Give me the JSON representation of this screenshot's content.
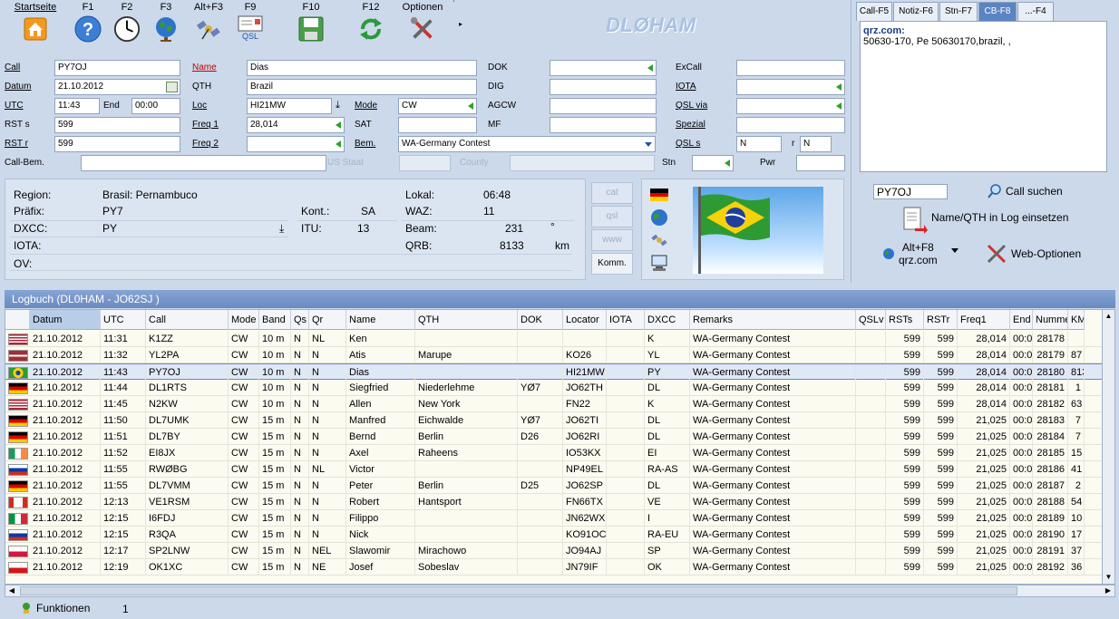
{
  "toolbar": {
    "buttons": [
      {
        "label": "Startseite",
        "icon": "home-icon"
      },
      {
        "label": "F1",
        "icon": "help-icon"
      },
      {
        "label": "F2",
        "icon": "clock-icon"
      },
      {
        "label": "F3",
        "icon": "globe-icon"
      },
      {
        "label": "Alt+F3",
        "icon": "satellite-icon"
      },
      {
        "label": "F9",
        "icon": "qsl-card-icon",
        "sub": "QSL"
      },
      {
        "label": "F10",
        "icon": "save-icon"
      },
      {
        "label": "F12",
        "icon": "refresh-icon"
      },
      {
        "label": "Optionen",
        "icon": "tools-icon"
      }
    ],
    "logo": "DLØHAM"
  },
  "form": {
    "call_label": "Call",
    "call": "PY7OJ",
    "datum_label": "Datum",
    "datum": "21.10.2012",
    "utc_label": "UTC",
    "utc": "11:43",
    "end_label": "End",
    "end": "00:00",
    "rsts_label": "RST s",
    "rsts": "599",
    "rstr_label": "RST r",
    "rstr": "599",
    "callbem_label": "Call-Bem.",
    "name_label": "Name",
    "name": "Dias",
    "qth_label": "QTH",
    "qth": "Brazil",
    "loc_label": "Loc",
    "loc": "HI21MW",
    "freq1_label": "Freq 1",
    "freq1": "28,014",
    "freq2_label": "Freq 2",
    "mode_label": "Mode",
    "mode": "CW",
    "sat_label": "SAT",
    "bem_label": "Bem.",
    "bem": "WA-Germany Contest",
    "usstaat_label": "US Staat",
    "county_label": "County",
    "dok_label": "DOK",
    "dig_label": "DIG",
    "agcw_label": "AGCW",
    "mf_label": "MF",
    "excall_label": "ExCall",
    "iota_label": "IOTA",
    "qslvia_label": "QSL via",
    "spezial_label": "Spezial",
    "qsls_label": "QSL s",
    "qsls": "N",
    "r_label": "r",
    "qslr": "N",
    "stn_label": "Stn",
    "pwr_label": "Pwr"
  },
  "tabs": [
    "Call-F5",
    "Notiz-F6",
    "Stn-F7",
    "CB-F8",
    "...-F4"
  ],
  "notes": {
    "title": "qrz.com:",
    "text": "50630-170, Pe 50630170,brazil, ,"
  },
  "lookup": {
    "call": "PY7OJ",
    "search": "Call suchen",
    "insert": "Name/QTH in Log einsetzen",
    "qrz_key": "Alt+F8",
    "qrz_site": "qrz.com",
    "web": "Web-Optionen"
  },
  "info": {
    "region_label": "Region:",
    "region": "Brasil: Pernambuco",
    "prefix_label": "Präfix:",
    "prefix": "PY7",
    "dxcc_label": "DXCC:",
    "dxcc": "PY",
    "iota_label": "IOTA:",
    "ov_label": "OV:",
    "kont_label": "Kont.:",
    "kont": "SA",
    "itu_label": "ITU:",
    "itu": "13",
    "lokal_label": "Lokal:",
    "lokal": "06:48",
    "waz_label": "WAZ:",
    "waz": "11",
    "beam_label": "Beam:",
    "beam": "231",
    "beam_unit": "°",
    "qrb_label": "QRB:",
    "qrb": "8133",
    "qrb_unit": "km"
  },
  "side_buttons": [
    "cat",
    "qsl",
    "www",
    "Komm."
  ],
  "log": {
    "title": "Logbuch  (DL0HAM - JO62SJ )",
    "columns": [
      "Datum",
      "UTC",
      "Call",
      "Mode",
      "Band",
      "Qs",
      "Qr",
      "Name",
      "QTH",
      "DOK",
      "Locator",
      "IOTA",
      "DXCC",
      "Remarks",
      "QSLv",
      "RSTs",
      "RSTr",
      "Freq1",
      "End",
      "Numme",
      "KM"
    ],
    "rows": [
      {
        "flag": "us",
        "c": [
          "21.10.2012",
          "11:31",
          "K1ZZ",
          "CW",
          "10 m",
          "N",
          "NL",
          "Ken",
          "",
          "",
          "",
          "",
          "K",
          "WA-Germany Contest",
          "",
          "599",
          "599",
          "28,014",
          "00:0",
          "28178",
          ""
        ]
      },
      {
        "flag": "lv",
        "c": [
          "21.10.2012",
          "11:32",
          "YL2PA",
          "CW",
          "10 m",
          "N",
          "N",
          "Atis",
          "Marupe",
          "",
          "KO26",
          "",
          "YL",
          "WA-Germany Contest",
          "",
          "599",
          "599",
          "28,014",
          "00:0",
          "28179",
          "87"
        ]
      },
      {
        "flag": "br",
        "sel": true,
        "c": [
          "21.10.2012",
          "11:43",
          "PY7OJ",
          "CW",
          "10 m",
          "N",
          "N",
          "Dias",
          "",
          "",
          "HI21MW",
          "",
          "PY",
          "WA-Germany Contest",
          "",
          "599",
          "599",
          "28,014",
          "00:0",
          "28180",
          "813"
        ]
      },
      {
        "flag": "de",
        "c": [
          "21.10.2012",
          "11:44",
          "DL1RTS",
          "CW",
          "10 m",
          "N",
          "N",
          "Siegfried",
          "Niederlehme",
          "YØ7",
          "JO62TH",
          "",
          "DL",
          "WA-Germany Contest",
          "",
          "599",
          "599",
          "28,014",
          "00:0",
          "28181",
          "1"
        ]
      },
      {
        "flag": "us",
        "c": [
          "21.10.2012",
          "11:45",
          "N2KW",
          "CW",
          "10 m",
          "N",
          "N",
          "Allen",
          "New York",
          "",
          "FN22",
          "",
          "K",
          "WA-Germany Contest",
          "",
          "599",
          "599",
          "28,014",
          "00:0",
          "28182",
          "63"
        ]
      },
      {
        "flag": "de",
        "c": [
          "21.10.2012",
          "11:50",
          "DL7UMK",
          "CW",
          "15 m",
          "N",
          "N",
          "Manfred",
          "Eichwalde",
          "YØ7",
          "JO62TI",
          "",
          "DL",
          "WA-Germany Contest",
          "",
          "599",
          "599",
          "21,025",
          "00:0",
          "28183",
          "7"
        ]
      },
      {
        "flag": "de",
        "c": [
          "21.10.2012",
          "11:51",
          "DL7BY",
          "CW",
          "15 m",
          "N",
          "N",
          "Bernd",
          "Berlin",
          "D26",
          "JO62RI",
          "",
          "DL",
          "WA-Germany Contest",
          "",
          "599",
          "599",
          "21,025",
          "00:0",
          "28184",
          "7"
        ]
      },
      {
        "flag": "ie",
        "c": [
          "21.10.2012",
          "11:52",
          "EI8JX",
          "CW",
          "15 m",
          "N",
          "N",
          "Axel",
          "Raheens",
          "",
          "IO53KX",
          "",
          "EI",
          "WA-Germany Contest",
          "",
          "599",
          "599",
          "21,025",
          "00:0",
          "28185",
          "15"
        ]
      },
      {
        "flag": "ru",
        "c": [
          "21.10.2012",
          "11:55",
          "RWØBG",
          "CW",
          "15 m",
          "N",
          "NL",
          "Victor",
          "",
          "",
          "NP49EL",
          "",
          "RA-AS",
          "WA-Germany Contest",
          "",
          "599",
          "599",
          "21,025",
          "00:0",
          "28186",
          "41"
        ]
      },
      {
        "flag": "de",
        "c": [
          "21.10.2012",
          "11:55",
          "DL7VMM",
          "CW",
          "15 m",
          "N",
          "N",
          "Peter",
          "Berlin",
          "D25",
          "JO62SP",
          "",
          "DL",
          "WA-Germany Contest",
          "",
          "599",
          "599",
          "21,025",
          "00:0",
          "28187",
          "2"
        ]
      },
      {
        "flag": "ca",
        "c": [
          "21.10.2012",
          "12:13",
          "VE1RSM",
          "CW",
          "15 m",
          "N",
          "N",
          "Robert",
          "Hantsport",
          "",
          "FN66TX",
          "",
          "VE",
          "WA-Germany Contest",
          "",
          "599",
          "599",
          "21,025",
          "00:0",
          "28188",
          "54"
        ]
      },
      {
        "flag": "it",
        "c": [
          "21.10.2012",
          "12:15",
          "I6FDJ",
          "CW",
          "15 m",
          "N",
          "N",
          "Filippo",
          "",
          "",
          "JN62WX",
          "",
          "I",
          "WA-Germany Contest",
          "",
          "599",
          "599",
          "21,025",
          "00:0",
          "28189",
          "10"
        ]
      },
      {
        "flag": "ru",
        "c": [
          "21.10.2012",
          "12:15",
          "R3QA",
          "CW",
          "15 m",
          "N",
          "N",
          "Nick",
          "",
          "",
          "KO91OC",
          "",
          "RA-EU",
          "WA-Germany Contest",
          "",
          "599",
          "599",
          "21,025",
          "00:0",
          "28190",
          "17"
        ]
      },
      {
        "flag": "pl",
        "c": [
          "21.10.2012",
          "12:17",
          "SP2LNW",
          "CW",
          "15 m",
          "N",
          "NEL",
          "Slawomir",
          "Mirachowo",
          "",
          "JO94AJ",
          "",
          "SP",
          "WA-Germany Contest",
          "",
          "599",
          "599",
          "21,025",
          "00:0",
          "28191",
          "37"
        ]
      },
      {
        "flag": "cz",
        "c": [
          "21.10.2012",
          "12:19",
          "OK1XC",
          "CW",
          "15 m",
          "N",
          "NE",
          "Josef",
          "Sobeslav",
          "",
          "JN79IF",
          "",
          "OK",
          "WA-Germany Contest",
          "",
          "599",
          "599",
          "21,025",
          "00:0",
          "28192",
          "36"
        ]
      }
    ]
  },
  "status": {
    "functions": "Funktionen",
    "count": "1"
  },
  "colors": {
    "accent": "#5b84c3",
    "header": "#6a8ac1",
    "background": "#ccd9ea"
  }
}
